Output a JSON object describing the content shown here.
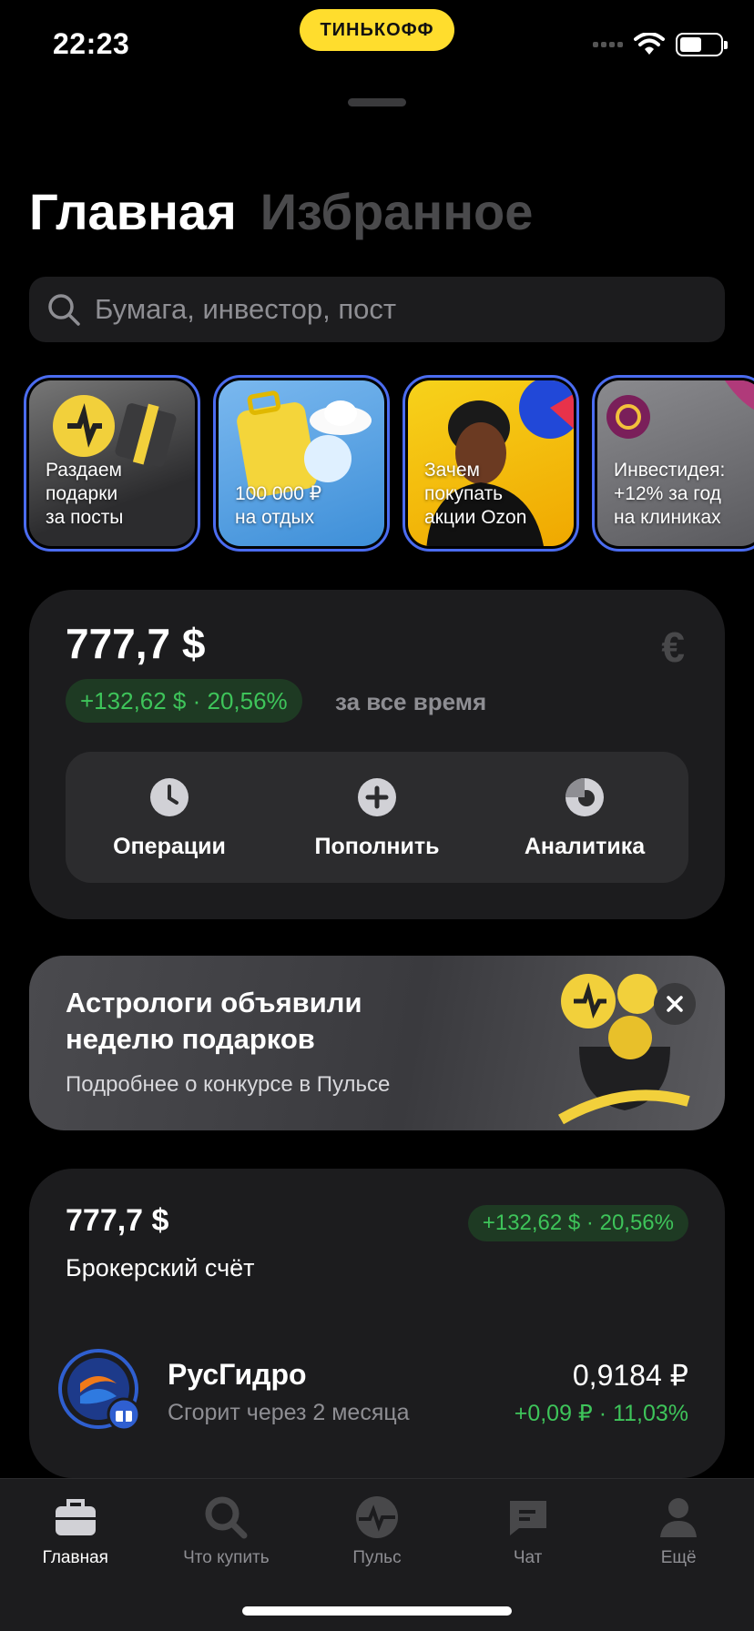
{
  "status": {
    "time": "22:23",
    "brand": "ТИНЬКОФФ"
  },
  "header": {
    "tab_active": "Главная",
    "tab_inactive": "Избранное"
  },
  "search": {
    "placeholder": "Бумага, инвестор, пост"
  },
  "stories": [
    {
      "label_lines": [
        "Раздаем",
        "подарки",
        "за посты"
      ]
    },
    {
      "label_lines": [
        "100 000 ₽",
        "на отдых"
      ]
    },
    {
      "label_lines": [
        "Зачем",
        "покупать",
        "акции Ozon"
      ]
    },
    {
      "label_lines": [
        "Инвестидея:",
        "+12% за год",
        "на клиниках"
      ]
    }
  ],
  "portfolio": {
    "value": "777,7 $",
    "currency_symbol": "€",
    "gain": "+132,62 $ · 20,56%",
    "period": "за все время",
    "actions": [
      {
        "label": "Операции",
        "icon": "clock-icon"
      },
      {
        "label": "Пополнить",
        "icon": "plus-icon"
      },
      {
        "label": "Аналитика",
        "icon": "pie-icon"
      }
    ]
  },
  "promo": {
    "title": "Астрологи объявили неделю подарков",
    "subtitle": "Подробнее о конкурсе в Пульсе"
  },
  "broker": {
    "value": "777,7 $",
    "name": "Брокерский счёт",
    "gain": "+132,62 $ · 20,56%",
    "asset": {
      "name": "РусГидро",
      "note": "Сгорит через 2 месяца",
      "price": "0,9184 ₽",
      "change": "+0,09 ₽ · 11,03%"
    }
  },
  "tabbar": [
    {
      "label": "Главная",
      "icon": "briefcase-icon",
      "active": true
    },
    {
      "label": "Что купить",
      "icon": "search-icon",
      "active": false
    },
    {
      "label": "Пульс",
      "icon": "pulse-icon",
      "active": false
    },
    {
      "label": "Чат",
      "icon": "chat-icon",
      "active": false
    },
    {
      "label": "Ещё",
      "icon": "profile-icon",
      "active": false
    }
  ],
  "colors": {
    "accent_yellow": "#ffdd2d",
    "gain_green": "#3ec45a",
    "story_border": "#4b6cf0"
  }
}
